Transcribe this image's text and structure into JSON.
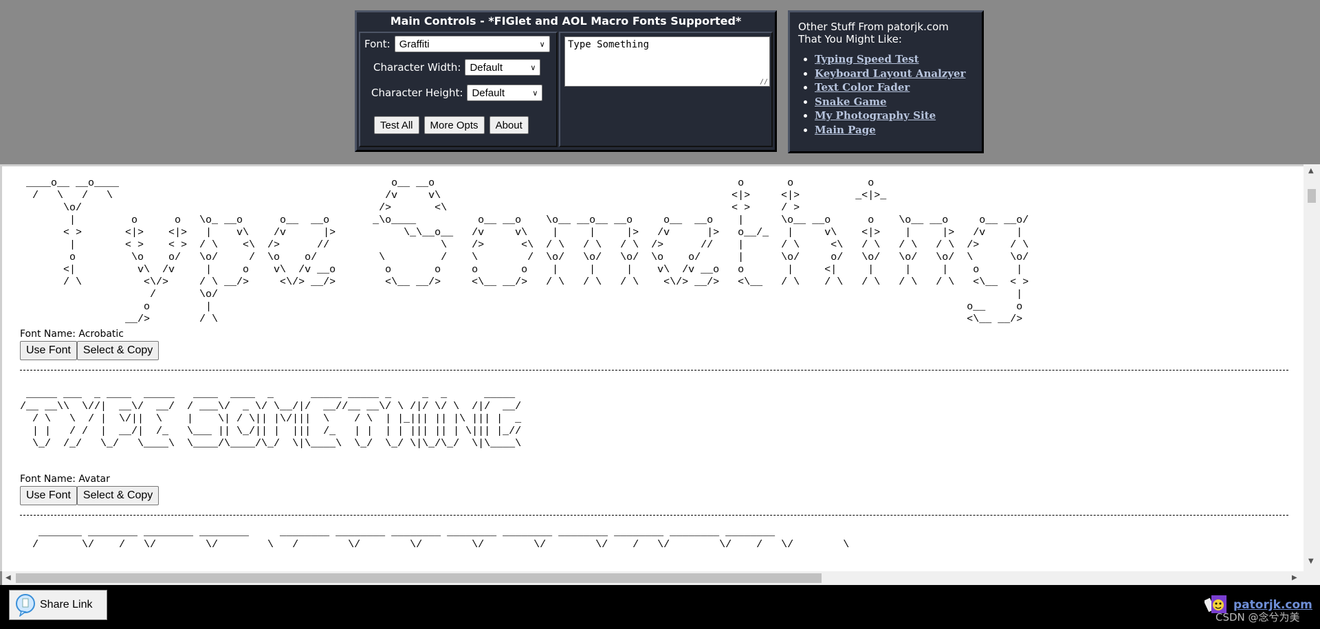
{
  "main_controls": {
    "title": "Main Controls - *FIGlet and AOL Macro Fonts Supported*",
    "font_label": "Font:",
    "font_value": "Graffiti",
    "char_width_label": "Character Width:",
    "char_width_value": "Default",
    "char_height_label": "Character Height:",
    "char_height_value": "Default",
    "buttons": [
      "Test All",
      "More Opts",
      "About"
    ],
    "text_input": "Type Something"
  },
  "other_stuff": {
    "heading_line1": "Other Stuff From patorjk.com",
    "heading_line2": "That You Might Like:",
    "links": [
      "Typing Speed Test",
      "Keyboard Layout Analzyer",
      "Text Color Fader",
      "Snake Game",
      "My Photography Site",
      "Main Page"
    ]
  },
  "results": [
    {
      "font_name_label": "Font Name: Acrobatic",
      "art": [
        " ____o__ __o____                                            o__ __o                                                 o       o            o",
        "  /   \\   /   \\                                            /v     v\\                                               <|>     <|>         _<|>_",
        "       \\o/                                                />       <\\                                              < >     / >",
        "        |         o      o   \\o_ __o      o__  __o       _\\o____          o__ __o    \\o__ __o__ __o     o__  __o    |      \\o__ __o      o    \\o__ __o     o__ __o/",
        "       < >       <|>    <|>   |    v\\    /v      |>           \\_\\__o__   /v     v\\    |     |     |>   /v      |>   o__/_   |     v\\    <|>    |     |>   /v     |",
        "        |        < >    < >  / \\    <\\  />      //                  \\    />      <\\  / \\   / \\   / \\  />      //    |      / \\     <\\   / \\   / \\   / \\  />     / \\",
        "        o         \\o    o/   \\o/     /  \\o    o/          \\         /    \\        /  \\o/   \\o/   \\o/  \\o    o/      |      \\o/     o/   \\o/   \\o/   \\o/  \\      \\o/",
        "       <|          v\\  /v     |     o    v\\  /v __o        o       o     o       o    |     |     |    v\\  /v __o   o       |     <|     |     |     |    o      |",
        "       / \\          <\\/>     / \\ __/>     <\\/> __/>        <\\__ __/>     <\\__ __/>   / \\   / \\   / \\    <\\/> __/>   <\\__   / \\    / \\   / \\   / \\   / \\   <\\__  < >",
        "                     /       \\o/                                                                                                                                 |",
        "                    o         |                                                                                                                          o__     o",
        "                 __/>        / \\                                                                                                                         <\\__ __/>"
      ],
      "buttons": [
        "Use Font",
        "Select & Copy"
      ]
    },
    {
      "font_name_label": "Font Name: Avatar",
      "art": [
        " _____ ___  _ ____  _____   ____  ____  _      _____ _____ _     _  _      _____",
        "/__ __\\\\  \\//|  __\\/  __/  / ___\\/  _ \\/ \\__/|/  __//__ __\\/ \\ /|/ \\/ \\  /|/  __/",
        "  / \\   \\  / |  \\/||  \\    |    \\| / \\|| |\\/|||  \\    / \\  | |_||| || |\\ ||| |  _",
        "  | |   / /  |  __/|  /_   \\___ || \\_/|| |  |||  /_   | |  | | ||| || | \\||| |_//",
        "  \\_/  /_/   \\_/   \\____\\  \\____/\\____/\\_/  \\|\\____\\  \\_/  \\_/ \\|\\_/\\_/  \\|\\____\\"
      ],
      "buttons": [
        "Use Font",
        "Select & Copy"
      ]
    },
    {
      "art": [
        "   _______ ________ ________ ________     ________ ________ ________ ________ ________ ________ ________ ________ ________",
        "  /       \\/    /   \\/        \\/        \\   /        \\/        \\/        \\/        \\/        \\/    /   \\/        \\/    /   \\/        \\"
      ]
    }
  ],
  "footer": {
    "share_label": "Share Link",
    "brand": "patorjk.com",
    "watermark": "CSDN @念兮为美"
  }
}
